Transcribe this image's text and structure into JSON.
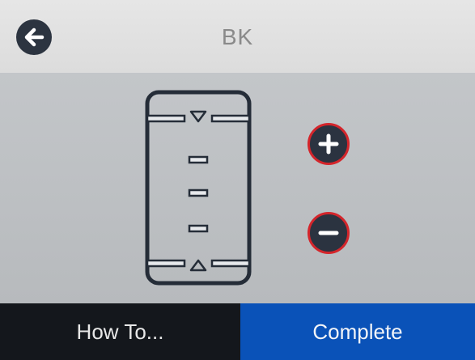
{
  "header": {
    "title": "BK",
    "back_icon": "arrow-left-icon"
  },
  "controls": {
    "increase_icon": "plus-icon",
    "decrease_icon": "minus-icon",
    "accent_color": "#d4252b"
  },
  "footer": {
    "howto_label": "How To...",
    "complete_label": "Complete",
    "complete_color": "#0a52b8"
  }
}
